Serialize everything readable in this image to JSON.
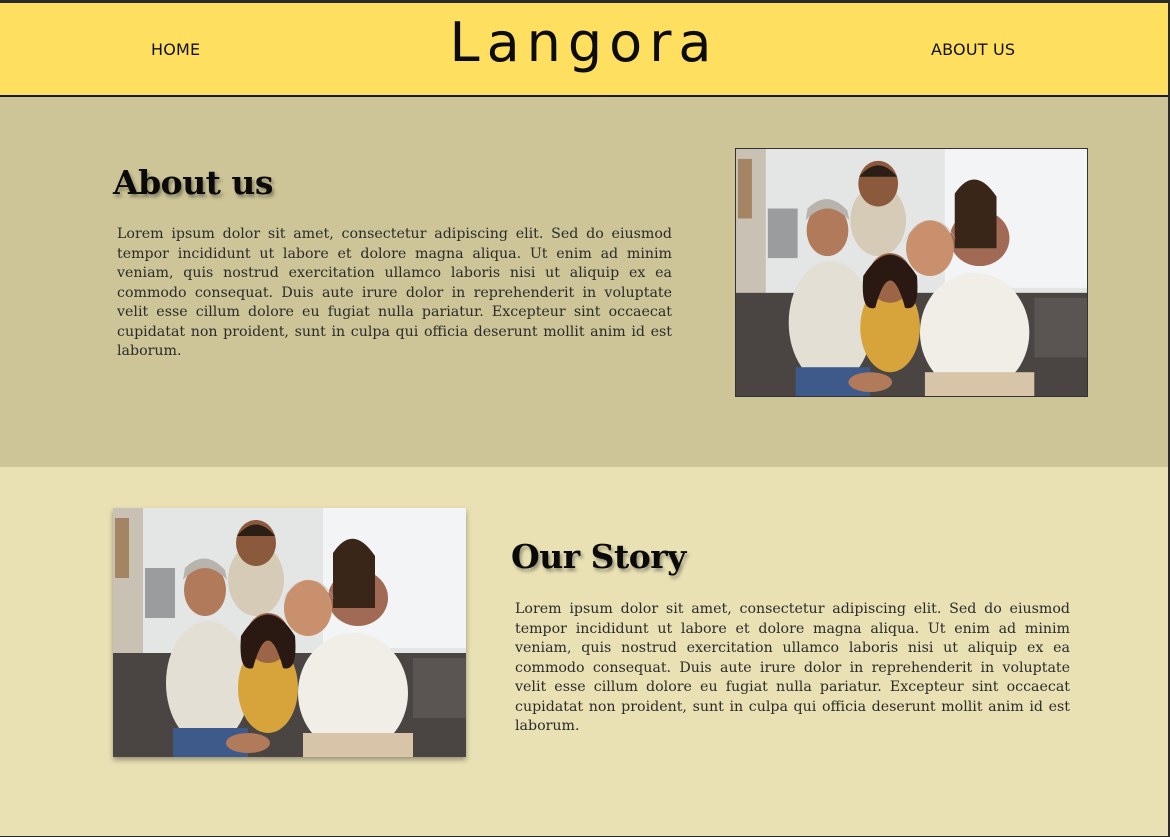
{
  "nav": {
    "home_label": "HOME",
    "brand": "Langora",
    "about_label": "ABOUT US"
  },
  "about": {
    "heading": "About us",
    "text": "Lorem ipsum dolor sit amet, consectetur adipiscing elit. Sed do eiusmod tempor incididunt ut labore et dolore magna aliqua. Ut enim ad minim veniam, quis nostrud exercitation ullamco laboris nisi ut aliquip ex ea commodo consequat. Duis aute irure dolor in reprehenderit in voluptate velit esse cillum dolore eu fugiat nulla pariatur. Excepteur sint occaecat cupidatat non proident, sunt in culpa qui officia deserunt mollit anim id est laborum.",
    "image": "family-photo"
  },
  "story": {
    "heading": "Our Story",
    "text": "Lorem ipsum dolor sit amet, consectetur adipiscing elit. Sed do eiusmod tempor incididunt ut labore et dolore magna aliqua. Ut enim ad minim veniam, quis nostrud exercitation ullamco laboris nisi ut aliquip ex ea commodo consequat. Duis aute irure dolor in reprehenderit in voluptate velit esse cillum dolore eu fugiat nulla pariatur. Excepteur sint occaecat cupidatat non proident, sunt in culpa qui officia deserunt mollit anim id est laborum.",
    "image": "family-photo"
  },
  "colors": {
    "header_bg": "#fedf5f",
    "about_bg": "#cdc597",
    "story_bg": "#e9e1b4"
  }
}
